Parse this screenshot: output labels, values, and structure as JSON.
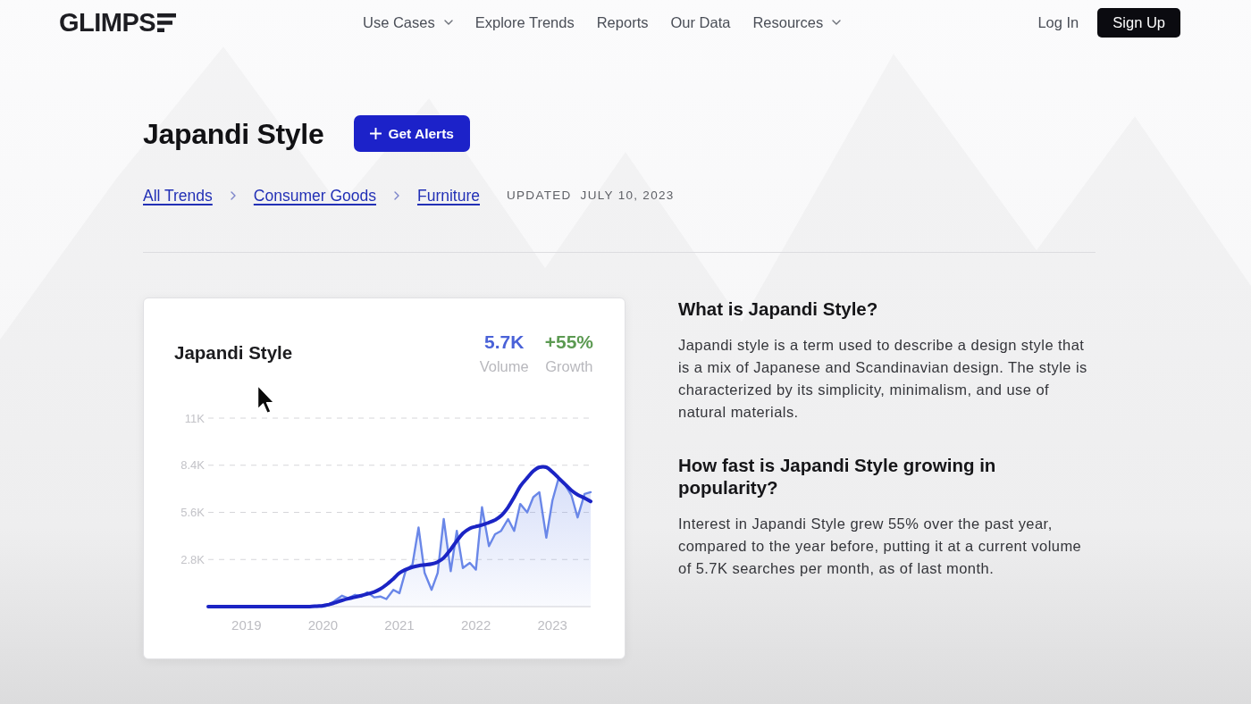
{
  "header": {
    "logo": "GLIMPS",
    "nav": [
      {
        "label": "Use Cases",
        "has_menu": true
      },
      {
        "label": "Explore Trends",
        "has_menu": false
      },
      {
        "label": "Reports",
        "has_menu": false
      },
      {
        "label": "Our Data",
        "has_menu": false
      },
      {
        "label": "Resources",
        "has_menu": true
      }
    ],
    "log_in": "Log In",
    "sign_up": "Sign Up"
  },
  "title": "Japandi Style",
  "alerts_button": "Get Alerts",
  "breadcrumb": [
    {
      "label": "All Trends"
    },
    {
      "label": "Consumer Goods"
    },
    {
      "label": "Furniture"
    }
  ],
  "updated": {
    "label": "UPDATED",
    "date": "JULY 10, 2023"
  },
  "trend_card": {
    "stats": [
      {
        "value": "5.7K",
        "label": "Volume",
        "color": "#4a62d8"
      },
      {
        "value": "+55%",
        "label": "Growth",
        "color": "#5c9a52"
      }
    ],
    "chart_data": {
      "type": "area",
      "title": "Japandi Style",
      "x": [
        2018.5,
        2018.58,
        2018.67,
        2018.75,
        2018.83,
        2018.92,
        2019,
        2019.08,
        2019.17,
        2019.25,
        2019.33,
        2019.42,
        2019.5,
        2019.58,
        2019.67,
        2019.75,
        2019.83,
        2019.92,
        2020,
        2020.08,
        2020.17,
        2020.25,
        2020.33,
        2020.42,
        2020.5,
        2020.58,
        2020.67,
        2020.75,
        2020.83,
        2020.92,
        2021,
        2021.08,
        2021.17,
        2021.25,
        2021.33,
        2021.42,
        2021.5,
        2021.58,
        2021.67,
        2021.75,
        2021.83,
        2021.92,
        2022,
        2022.08,
        2022.17,
        2022.25,
        2022.33,
        2022.42,
        2022.5,
        2022.58,
        2022.67,
        2022.75,
        2022.83,
        2022.92,
        2023,
        2023.08,
        2023.17,
        2023.25,
        2023.33,
        2023.42,
        2023.5
      ],
      "xlim": [
        2018.5,
        2023.5
      ],
      "ylim": [
        0,
        11200
      ],
      "xticks": [
        2019,
        2020,
        2021,
        2022,
        2023
      ],
      "yticks": [
        {
          "value": 2800,
          "label": "2.8K"
        },
        {
          "value": 5600,
          "label": "5.6K"
        },
        {
          "value": 8400,
          "label": "8.4K"
        },
        {
          "value": 11200,
          "label": "11K"
        }
      ],
      "grid": true,
      "series": [
        {
          "color": "#6a87e8",
          "values": [
            0,
            0,
            0,
            0,
            0,
            0,
            0,
            0,
            0,
            0,
            0,
            0,
            0,
            0,
            0,
            0,
            0,
            0,
            0,
            100,
            400,
            650,
            500,
            700,
            600,
            850,
            550,
            600,
            450,
            1000,
            800,
            2100,
            2500,
            4700,
            2000,
            1000,
            2000,
            5200,
            2100,
            4500,
            2300,
            2600,
            2200,
            5900,
            3600,
            4300,
            4500,
            5200,
            4500,
            6100,
            5600,
            6500,
            6800,
            4100,
            6300,
            7600,
            7200,
            6600,
            5300,
            6700,
            6800
          ]
        },
        {
          "type": "line",
          "color": "#1b24c4",
          "values": [
            0,
            0,
            0,
            0,
            0,
            0,
            0,
            0,
            0,
            0,
            0,
            0,
            0,
            0,
            0,
            0,
            0,
            30,
            60,
            130,
            250,
            370,
            470,
            560,
            650,
            750,
            870,
            1050,
            1300,
            1650,
            2000,
            2200,
            2350,
            2430,
            2480,
            2530,
            2650,
            2900,
            3400,
            3900,
            4350,
            4650,
            4760,
            4850,
            5000,
            5150,
            5400,
            5900,
            6500,
            7150,
            7650,
            8050,
            8280,
            8280,
            8000,
            7650,
            7250,
            6900,
            6650,
            6450,
            6250
          ]
        }
      ]
    }
  },
  "about": [
    {
      "heading": "What is Japandi Style?",
      "text": "Japandi style is a term used to describe a design style that is a mix of Japanese and Scandinavian design. The style is characterized by its simplicity, minimalism, and use of natural materials."
    },
    {
      "heading": "How fast is Japandi Style growing in popularity?",
      "text": "Interest in Japandi Style grew 55% over the past year, compared to the year before, putting it at a current volume of 5.7K searches per month, as of last month."
    }
  ]
}
